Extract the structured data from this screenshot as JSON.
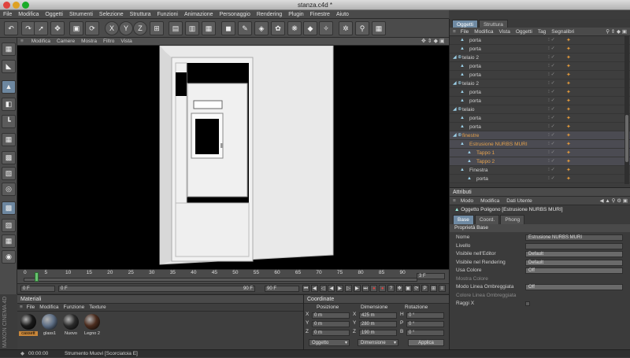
{
  "window": {
    "title": "stanza.c4d *"
  },
  "menubar": [
    "File",
    "Modifica",
    "Oggetti",
    "Strumenti",
    "Selezione",
    "Struttura",
    "Funzioni",
    "Animazione",
    "Personaggio",
    "Rendering",
    "Plugin",
    "Finestre",
    "Aiuto"
  ],
  "viewport_menu": [
    "Modifica",
    "Camere",
    "Mostra",
    "Filtro",
    "Vista"
  ],
  "toolbar_icons": [
    "undo-icon",
    "redo-icon",
    "select-icon",
    "move-icon",
    "scale-icon",
    "rotate-icon",
    "x-axis-icon",
    "y-axis-icon",
    "z-axis-icon",
    "coordinate-system-icon",
    "render-region-icon",
    "render-view-icon",
    "render-settings-icon",
    "cube-icon",
    "pen-spline-icon",
    "subdivision-icon",
    "array-icon",
    "environment-icon",
    "light-icon",
    "deformer-icon",
    "scene-icon",
    "camera-icon",
    "timeline-icon",
    "material-sphere-icon"
  ],
  "timeline": {
    "ticks": [
      "0",
      "5",
      "10",
      "15",
      "20",
      "25",
      "30",
      "35",
      "40",
      "45",
      "50",
      "55",
      "60",
      "65",
      "70",
      "75",
      "80",
      "85",
      "90"
    ],
    "current_frame": "3 F",
    "start_field": "0 F",
    "left_field": "0 F",
    "right_field": "90 F",
    "end_field": "90 F"
  },
  "materials": {
    "title": "Materiali",
    "menu": [
      "File",
      "Modifica",
      "Funzione",
      "Texture"
    ],
    "items": [
      {
        "label": "cassett",
        "color": "#1a1a1a"
      },
      {
        "label": "glass1",
        "color": "#5e6f86"
      },
      {
        "label": "Nuovo",
        "color": "#2b2b2b"
      },
      {
        "label": "Legno 2",
        "color": "#4b2c1e"
      }
    ]
  },
  "coordinates": {
    "title": "Coordinate",
    "headers": [
      "Posizione",
      "Dimensione",
      "Rotazione"
    ],
    "rows": [
      {
        "axis": "X",
        "pos": "0 m",
        "dim_axis": "X",
        "dim": "425 m",
        "rot_axis": "H",
        "rot": "0 °"
      },
      {
        "axis": "Y",
        "pos": "0 m",
        "dim_axis": "Y",
        "dim": "280 m",
        "rot_axis": "P",
        "rot": "0 °"
      },
      {
        "axis": "Z",
        "pos": "0 m",
        "dim_axis": "Z",
        "dim": "190 m",
        "rot_axis": "B",
        "rot": "0 °"
      }
    ],
    "mode_dropdown": "Oggetto",
    "size_dropdown": "Dimensione",
    "apply_button": "Applica"
  },
  "status": {
    "time": "00:00:00",
    "message": "Strumento Muovi [Scorciatoia E]"
  },
  "object_manager": {
    "tabs": [
      "Oggetti",
      "Struttura"
    ],
    "menu": [
      "File",
      "Modifica",
      "Vista",
      "Oggetti",
      "Tag",
      "Segnalibri"
    ],
    "rows": [
      {
        "name": "porta",
        "indent": 2,
        "hl": false
      },
      {
        "name": "porta",
        "indent": 2,
        "hl": false
      },
      {
        "name": "telaio 2",
        "indent": 1,
        "hl": false
      },
      {
        "name": "porta",
        "indent": 2,
        "hl": false
      },
      {
        "name": "porta",
        "indent": 2,
        "hl": false
      },
      {
        "name": "telaio 2",
        "indent": 1,
        "hl": false
      },
      {
        "name": "porta",
        "indent": 2,
        "hl": false
      },
      {
        "name": "porta",
        "indent": 2,
        "hl": false
      },
      {
        "name": "telaio",
        "indent": 1,
        "hl": false
      },
      {
        "name": "porta",
        "indent": 2,
        "hl": false
      },
      {
        "name": "porta",
        "indent": 2,
        "hl": false
      },
      {
        "name": "finestre",
        "indent": 1,
        "hl": true
      },
      {
        "name": "Estrusione NURBS MURI",
        "indent": 2,
        "hl": true
      },
      {
        "name": "Tappo 1",
        "indent": 3,
        "hl": true
      },
      {
        "name": "Tappo 2",
        "indent": 3,
        "hl": true
      },
      {
        "name": "Finestra",
        "indent": 2,
        "hl": false
      },
      {
        "name": "porta",
        "indent": 3,
        "hl": false
      }
    ]
  },
  "attributes": {
    "title": "Attributi",
    "menu": [
      "Modo",
      "Modifica",
      "Dati Utente"
    ],
    "object_title": "Oggetto Poligono [Estrusione NURBS MURI]",
    "tabs": [
      "Base",
      "Coord.",
      "Phong"
    ],
    "section": "Proprietà Base",
    "fields": [
      {
        "label": "Nome",
        "value": "Estrusione NURBS MURI"
      },
      {
        "label": "Livello",
        "value": ""
      },
      {
        "label": "Visibile nell'Editor",
        "value": "Default"
      },
      {
        "label": "Visibile nel Rendering",
        "value": "Default"
      },
      {
        "label": "Usa Colore",
        "value": "Off"
      },
      {
        "label": "Mostra Colore",
        "value": ""
      },
      {
        "label": "Modo Linea Ombreggiata",
        "value": "Off"
      },
      {
        "label": "Colore Linea Ombreggiata",
        "value": ""
      },
      {
        "label": "Raggi X",
        "value": ""
      }
    ]
  },
  "brand": "MAXON CINEMA 4D"
}
